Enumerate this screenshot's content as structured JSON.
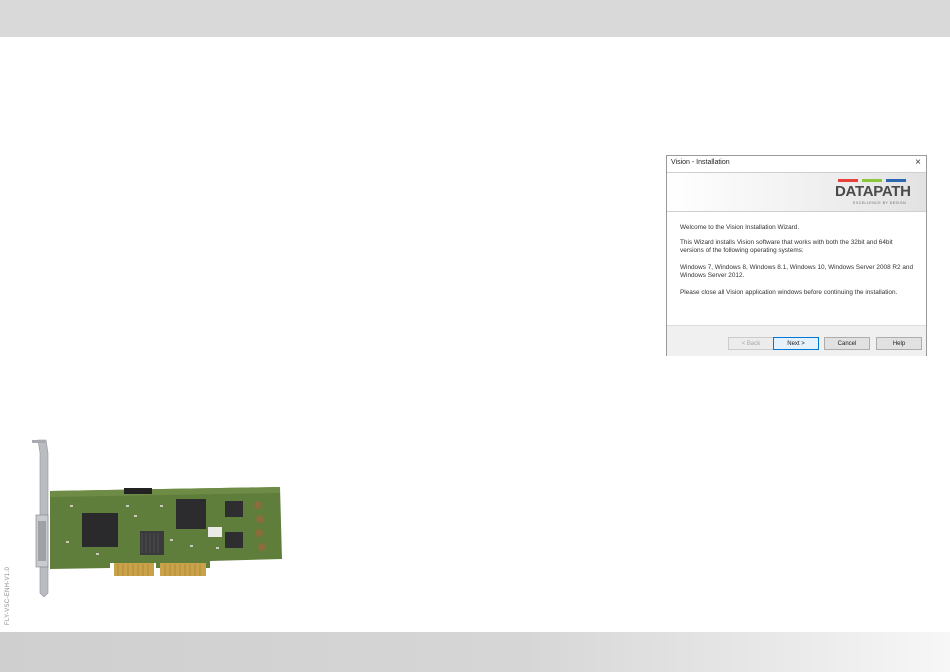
{
  "doc_code": "FLY-VSC-ENH-V1.0",
  "dialog": {
    "title": "Vision - Installation",
    "close_glyph": "×",
    "logo": {
      "text": "DATAPATH",
      "tagline": "EXCELLENCE BY DESIGN",
      "bar_colors": [
        "#e8403a",
        "#8cc63f",
        "#2e67b1"
      ]
    },
    "welcome": "Welcome to the Vision Installation Wizard.",
    "intro": "This Wizard installs Vision software that works with both the 32bit and 64bit versions of the following operating systems:",
    "os_list": "Windows 7, Windows 8, Windows 8.1, Windows 10, Windows Server 2008 R2 and Windows Server 2012.",
    "note": "Please close all Vision application windows before continuing the installation.",
    "buttons": {
      "back": "< Back",
      "next": "Next >",
      "cancel": "Cancel",
      "help": "Help"
    }
  }
}
